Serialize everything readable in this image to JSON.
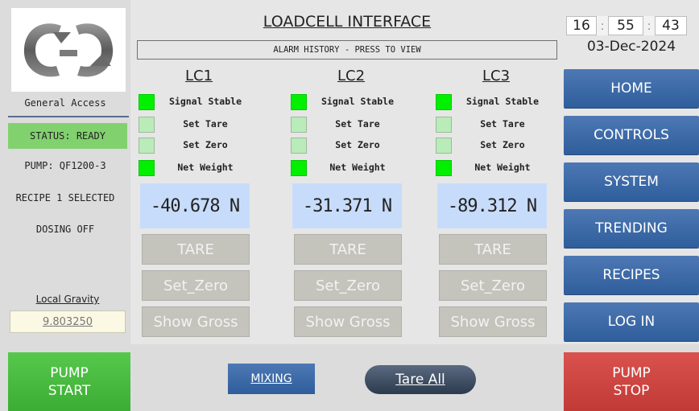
{
  "header": {
    "title": "LOADCELL INTERFACE",
    "alarm_history": "ALARM HISTORY - PRESS TO VIEW"
  },
  "sidebar": {
    "access": "General Access",
    "status": "STATUS: READY",
    "pump": "PUMP: QF1200-3",
    "recipe": "RECIPE 1 SELECTED",
    "dosing": "DOSING OFF",
    "gravity_label": "Local Gravity",
    "gravity_value": "9.803250"
  },
  "loadcells": [
    {
      "name": "LC1",
      "indicators": [
        {
          "label": "Signal Stable",
          "on": true
        },
        {
          "label": "Set Tare",
          "on": false
        },
        {
          "label": "Set Zero",
          "on": false
        },
        {
          "label": "Net Weight",
          "on": true
        }
      ],
      "value": "-40.678 N",
      "buttons": {
        "tare": "TARE",
        "set_zero": "Set_Zero",
        "show_gross": "Show Gross"
      }
    },
    {
      "name": "LC2",
      "indicators": [
        {
          "label": "Signal Stable",
          "on": true
        },
        {
          "label": "Set Tare",
          "on": false
        },
        {
          "label": "Set Zero",
          "on": false
        },
        {
          "label": "Net Weight",
          "on": true
        }
      ],
      "value": "-31.371 N",
      "buttons": {
        "tare": "TARE",
        "set_zero": "Set_Zero",
        "show_gross": "Show Gross"
      }
    },
    {
      "name": "LC3",
      "indicators": [
        {
          "label": "Signal Stable",
          "on": true
        },
        {
          "label": "Set Tare",
          "on": false
        },
        {
          "label": "Set Zero",
          "on": false
        },
        {
          "label": "Net Weight",
          "on": true
        }
      ],
      "value": "-89.312 N",
      "buttons": {
        "tare": "TARE",
        "set_zero": "Set_Zero",
        "show_gross": "Show Gross"
      }
    }
  ],
  "clock": {
    "hours": "16",
    "minutes": "55",
    "seconds": "43",
    "sep": ":",
    "date": "03-Dec-2024"
  },
  "nav": {
    "home": "HOME",
    "controls": "CONTROLS",
    "system": "SYSTEM",
    "trending": "TRENDING",
    "recipes": "RECIPES",
    "login": "LOG IN"
  },
  "bottom": {
    "pump_start_line1": "PUMP",
    "pump_start_line2": "START",
    "mixing": "MIXING",
    "tare_all": "Tare All",
    "pump_stop_line1": "PUMP",
    "pump_stop_line2": "STOP"
  },
  "colors": {
    "indicator_on": "#00f000",
    "indicator_off": "#b9ecb9",
    "status_ready": "#82d16f",
    "nav_blue": "#3a6aa8",
    "pump_start": "#48bb40",
    "pump_stop": "#cc4541"
  },
  "icons": {
    "logo": "company-logo"
  }
}
